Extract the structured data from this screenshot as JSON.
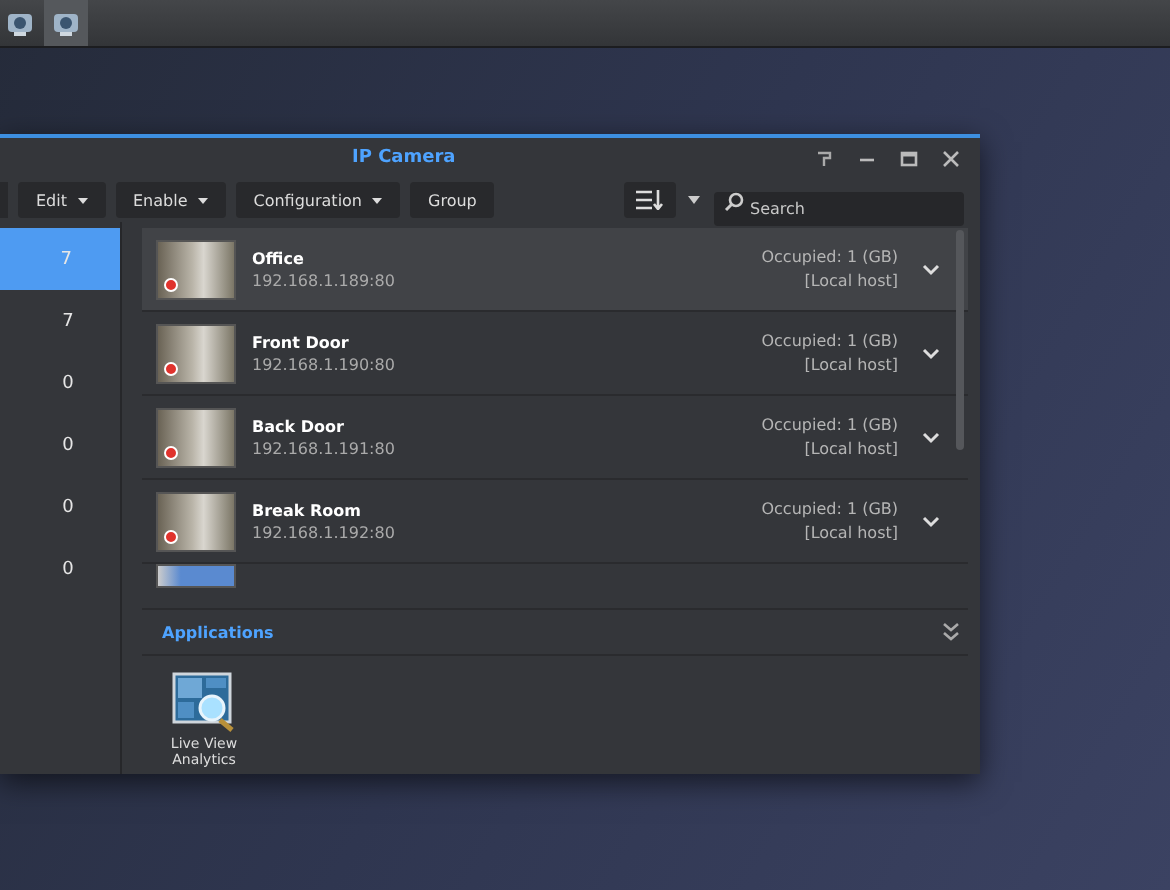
{
  "taskbar": {
    "items": [
      {
        "selected": false
      },
      {
        "selected": true
      }
    ]
  },
  "window": {
    "title": "IP Camera"
  },
  "toolbar": {
    "buttons": [
      {
        "label": "Edit",
        "dropdown": true
      },
      {
        "label": "Enable",
        "dropdown": true
      },
      {
        "label": "Configuration",
        "dropdown": true
      },
      {
        "label": "Group",
        "dropdown": false
      }
    ],
    "search": {
      "placeholder": "Search"
    }
  },
  "sidebar": {
    "items": [
      {
        "count": "7",
        "selected": true
      },
      {
        "count": "7",
        "selected": false
      },
      {
        "count": "0",
        "selected": false
      },
      {
        "count": "0",
        "selected": false
      },
      {
        "count": "0",
        "selected": false
      },
      {
        "count": "0",
        "selected": false
      }
    ]
  },
  "cameras": [
    {
      "name": "Office",
      "address": "192.168.1.189:80",
      "occupied": "Occupied: 1 (GB)",
      "host": "[Local host]",
      "recording": true,
      "selected": true
    },
    {
      "name": "Front Door",
      "address": "192.168.1.190:80",
      "occupied": "Occupied: 1 (GB)",
      "host": "[Local host]",
      "recording": true,
      "selected": false
    },
    {
      "name": "Back Door",
      "address": "192.168.1.191:80",
      "occupied": "Occupied: 1 (GB)",
      "host": "[Local host]",
      "recording": true,
      "selected": false
    },
    {
      "name": "Break Room",
      "address": "192.168.1.192:80",
      "occupied": "Occupied: 1 (GB)",
      "host": "[Local host]",
      "recording": true,
      "selected": false
    }
  ],
  "applications": {
    "title": "Applications",
    "apps": [
      {
        "label": "Live View Analytics"
      }
    ]
  }
}
